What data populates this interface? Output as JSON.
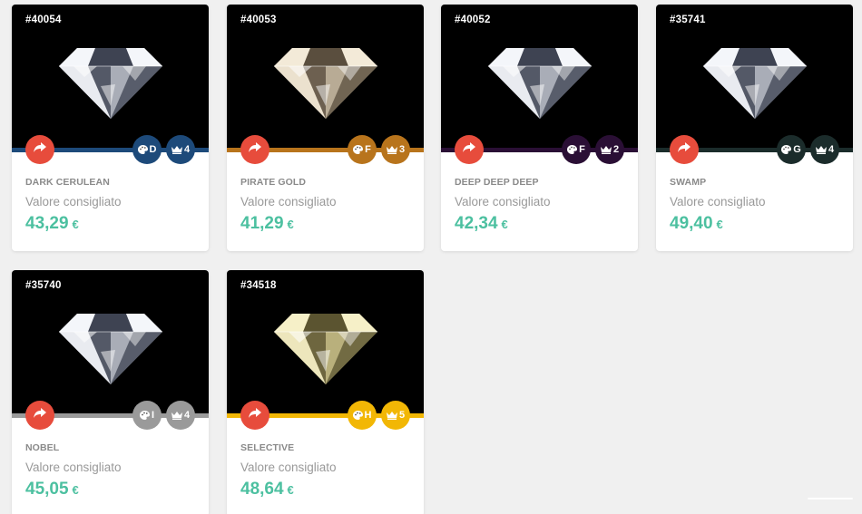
{
  "label_value": "Valore consigliato",
  "currency": "€",
  "cards": [
    {
      "code": "#40054",
      "name": "DARK CERULEAN",
      "price": "43,29",
      "grade": "D",
      "rank": "4",
      "color": "#1d4a7a",
      "tint": "cool"
    },
    {
      "code": "#40053",
      "name": "PIRATE GOLD",
      "price": "41,29",
      "grade": "F",
      "rank": "3",
      "color": "#b8741c",
      "tint": "warm"
    },
    {
      "code": "#40052",
      "name": "DEEP DEEP DEEP",
      "price": "42,34",
      "grade": "F",
      "rank": "2",
      "color": "#2a0f35",
      "tint": "cool"
    },
    {
      "code": "#35741",
      "name": "SWAMP",
      "price": "49,40",
      "grade": "G",
      "rank": "4",
      "color": "#1b2c2b",
      "tint": "cool"
    },
    {
      "code": "#35740",
      "name": "NOBEL",
      "price": "45,05",
      "grade": "I",
      "rank": "4",
      "color": "#9a9a9a",
      "tint": "cool"
    },
    {
      "code": "#34518",
      "name": "SELECTIVE",
      "price": "48,64",
      "grade": "H",
      "rank": "5",
      "color": "#f2b705",
      "tint": "gold"
    }
  ],
  "icons": {
    "share": "share-arrow-icon",
    "grade": "palette-icon",
    "rank": "crown-icon"
  }
}
